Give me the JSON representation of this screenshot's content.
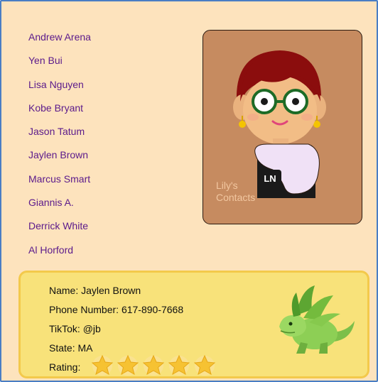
{
  "contacts": [
    "Andrew Arena",
    "Yen Bui",
    "Lisa Nguyen",
    "Kobe Bryant",
    "Jason Tatum",
    "Jaylen Brown",
    "Marcus Smart",
    "Giannis A.",
    "Derrick White",
    "Al Horford"
  ],
  "photo_card": {
    "brand_line1": "Lily's",
    "brand_line2": "Contacts",
    "badge_initials": "LN"
  },
  "details": {
    "name": "Name: Jaylen Brown",
    "phone": "Phone Number: 617-890-7668",
    "tiktok": "TikTok: @jb",
    "state": "State: MA",
    "rating_label": "Rating:",
    "rating": 5,
    "rating_max": 5
  },
  "colors": {
    "background": "#fde3bd",
    "link": "#5b1a8b",
    "card": "#c68b60",
    "details_bg": "#f8e27a",
    "star": "#f6c232"
  }
}
